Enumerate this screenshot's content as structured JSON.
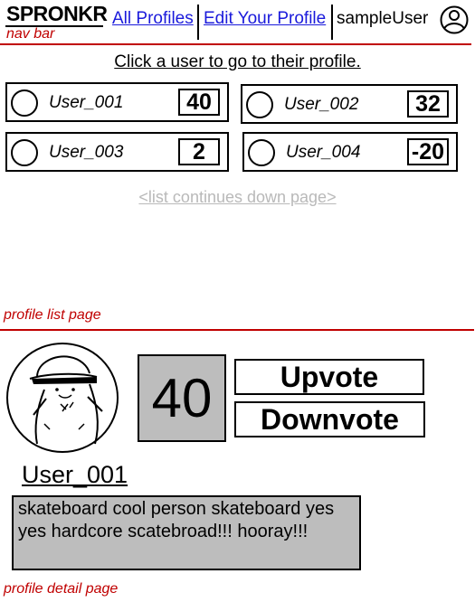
{
  "nav": {
    "brand": "SPRONKR",
    "note": "nav bar",
    "links": [
      {
        "label": "All Profiles"
      },
      {
        "label": "Edit Your Profile"
      }
    ],
    "username": "sampleUser",
    "user_icon": "user-account-icon"
  },
  "list_page": {
    "hint": "Click a user to go to their profile.",
    "profiles": [
      {
        "name": "User_001",
        "score": "40"
      },
      {
        "name": "User_002",
        "score": "32"
      },
      {
        "name": "User_003",
        "score": "2"
      },
      {
        "name": "User_004",
        "score": "-20"
      }
    ],
    "continues": "<list continues down page>",
    "note": "profile list page"
  },
  "detail_page": {
    "score": "40",
    "upvote_label": "Upvote",
    "downvote_label": "Downvote",
    "name": "User_001",
    "bio": "skateboard cool person skateboard yes yes hardcore scatebroad!!! hooray!!!",
    "note": "profile detail page"
  },
  "colors": {
    "annotation": "#c00000",
    "link": "#1a1adb",
    "muted": "#b9b9b9",
    "panel": "#bdbdbd"
  }
}
